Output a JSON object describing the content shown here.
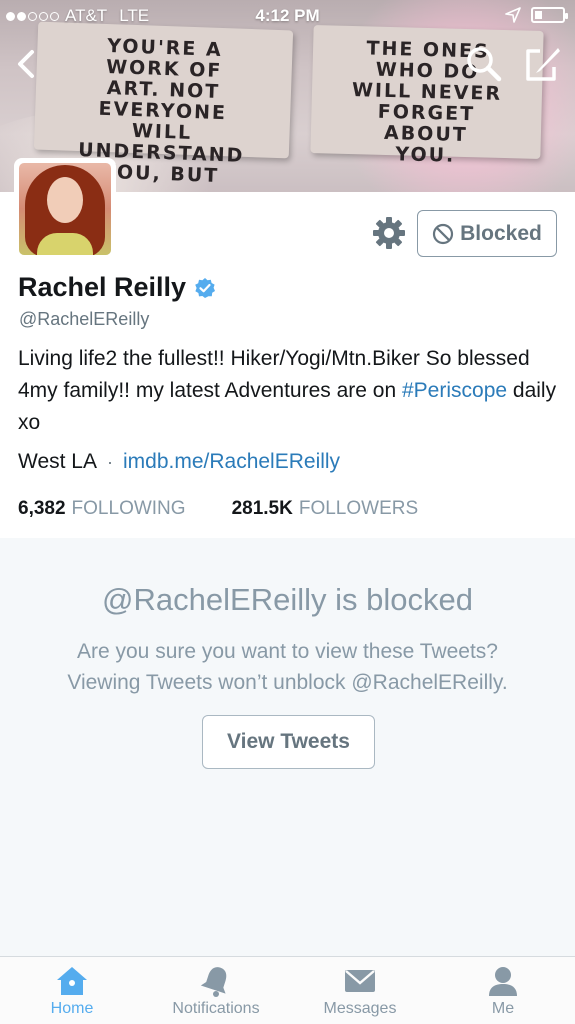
{
  "status_bar": {
    "carrier": "AT&T",
    "network": "LTE",
    "time": "4:12 PM",
    "signal_bars_filled": 2,
    "signal_bars_total": 5
  },
  "banner": {
    "left_card": [
      "YOU'RE A",
      "WORK OF",
      "ART. NOT",
      "EVERYONE",
      "WILL",
      "UNDERSTAND",
      "YOU, BUT"
    ],
    "right_card": [
      "THE ONES",
      "WHO DO",
      "WILL NEVER",
      "FORGET",
      "ABOUT",
      "YOU."
    ]
  },
  "nav": {
    "back_icon": "chevron-left-icon",
    "search_icon": "search-icon",
    "compose_icon": "compose-icon"
  },
  "profile": {
    "name": "Rachel Reilly",
    "handle": "@RachelEReilly",
    "verified": true,
    "bio_text": "Living life2 the fullest!! Hiker/Yogi/Mtn.Biker So blessed 4my family!! my latest Adventures are on ",
    "bio_hashtag": "#Periscope",
    "bio_tail": " daily xo",
    "location": "West LA",
    "separator": "·",
    "website": "imdb.me/RachelEReilly",
    "following_count": "6,382",
    "following_label": "FOLLOWING",
    "followers_count": "281.5K",
    "followers_label": "FOLLOWERS",
    "blocked_button": "Blocked",
    "settings_icon": "gear-icon"
  },
  "blocked_panel": {
    "title": "@RachelEReilly is blocked",
    "line1": "Are you sure you want to view these Tweets?",
    "line2": "Viewing Tweets won’t unblock @RachelEReilly.",
    "button": "View Tweets"
  },
  "tabbar": {
    "tabs": [
      {
        "label": "Home",
        "icon": "home-icon",
        "active": true
      },
      {
        "label": "Notifications",
        "icon": "bell-icon",
        "active": false
      },
      {
        "label": "Messages",
        "icon": "envelope-icon",
        "active": false
      },
      {
        "label": "Me",
        "icon": "person-icon",
        "active": false
      }
    ]
  },
  "colors": {
    "accent": "#55acee",
    "link": "#2b7bb9",
    "muted": "#8899a6",
    "panel_bg": "#f5f8fa",
    "verified": "#55acee"
  }
}
